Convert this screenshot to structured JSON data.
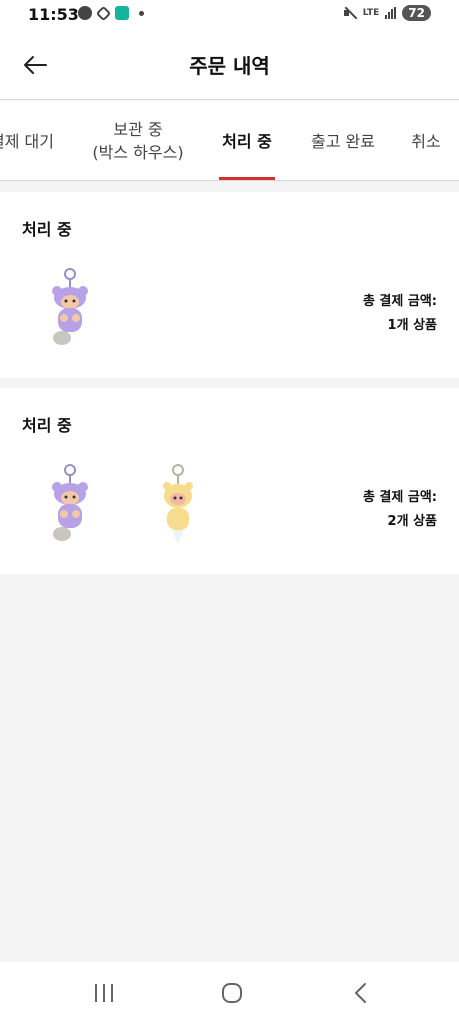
{
  "status_bar": {
    "time": "11:53",
    "network": "LTE",
    "battery": "72",
    "icons": [
      "message-icon",
      "sync-off-icon",
      "app-notification-icon",
      "dot-icon",
      "mute-icon",
      "signal-icon"
    ]
  },
  "header": {
    "back_icon": "arrow-left-icon",
    "title": "주문 내역"
  },
  "tabs": [
    {
      "label": "결제 대기",
      "active": false
    },
    {
      "label": "보관 중\n(박스 하우스)",
      "active": false
    },
    {
      "label": "처리 중",
      "active": true
    },
    {
      "label": "출고 완료",
      "active": false
    },
    {
      "label": "취소",
      "active": false
    }
  ],
  "tab_labels": {
    "payment_pending": "결제 대기",
    "storage_line1": "보관 중",
    "storage_line2": "(박스 하우스)",
    "processing": "처리 중",
    "shipped": "출고 완료",
    "cancelled": "취소"
  },
  "orders": [
    {
      "status": "처리 중",
      "total_label": "총 결제 금액:",
      "item_count": "1개 상품",
      "items": [
        {
          "name": "purple-plush-keychain",
          "color": "#b7a2e8"
        }
      ]
    },
    {
      "status": "처리 중",
      "total_label": "총 결제 금액:",
      "item_count": "2개 상품",
      "items": [
        {
          "name": "purple-plush-keychain",
          "color": "#b7a2e8"
        },
        {
          "name": "yellow-plush-keychain",
          "color": "#f6dc8c"
        }
      ]
    }
  ],
  "nav_bar": {
    "buttons": [
      "recent-apps-icon",
      "home-icon",
      "back-nav-icon"
    ]
  },
  "colors": {
    "accent": "#d32f2f",
    "background": "#f4f4f4",
    "card": "#ffffff"
  }
}
